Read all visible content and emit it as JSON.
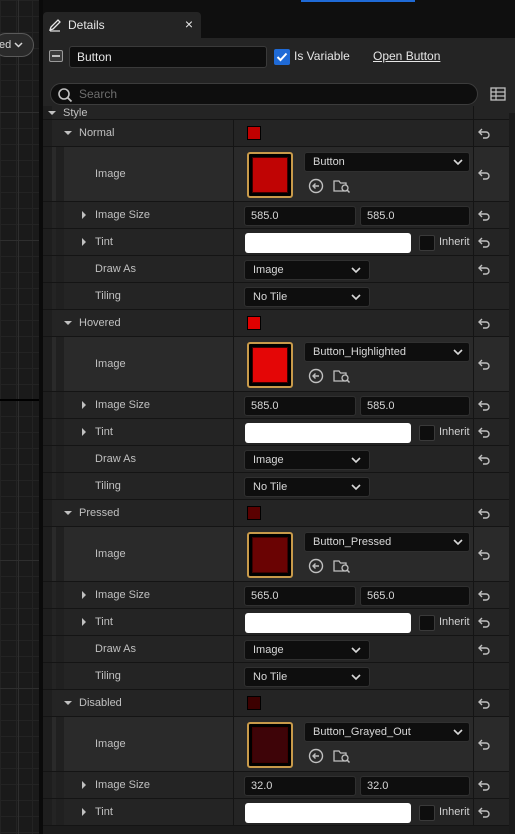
{
  "graph": {
    "dropdown_label": "ed"
  },
  "tab": {
    "title": "Details",
    "close": "×"
  },
  "header": {
    "name_value": "Button",
    "is_variable_label": "Is Variable",
    "is_variable_checked": true,
    "open_button_label": "Open Button",
    "search_placeholder": "Search"
  },
  "section": {
    "label": "Style"
  },
  "states": [
    {
      "label": "Normal",
      "swatch_color": "#c00000",
      "thumb_color": "#c00404",
      "image_name": "Button",
      "image_size": [
        "585.0",
        "585.0"
      ],
      "tint_label": "Tint",
      "inherit_label": "Inherit",
      "draw_as_label": "Draw As",
      "draw_as_value": "Image",
      "tiling_label": "Tiling",
      "tiling_value": "No Tile"
    },
    {
      "label": "Hovered",
      "swatch_color": "#e00000",
      "thumb_color": "#e40606",
      "image_name": "Button_Highlighted",
      "image_size": [
        "585.0",
        "585.0"
      ],
      "tint_label": "Tint",
      "inherit_label": "Inherit",
      "draw_as_label": "Draw As",
      "draw_as_value": "Image",
      "tiling_label": "Tiling",
      "tiling_value": "No Tile"
    },
    {
      "label": "Pressed",
      "swatch_color": "#5a0000",
      "thumb_color": "#6a0303",
      "image_name": "Button_Pressed",
      "image_size": [
        "565.0",
        "565.0"
      ],
      "tint_label": "Tint",
      "inherit_label": "Inherit",
      "draw_as_label": "Draw As",
      "draw_as_value": "Image",
      "tiling_label": "Tiling",
      "tiling_value": "No Tile"
    },
    {
      "label": "Disabled",
      "swatch_color": "#3c0000",
      "thumb_color": "#3e0408",
      "image_name": "Button_Grayed_Out",
      "image_size": [
        "32.0",
        "32.0"
      ],
      "tint_label": "Tint",
      "inherit_label": "Inherit"
    }
  ],
  "labels": {
    "image": "Image",
    "image_size": "Image Size"
  },
  "colors": {
    "accent": "#1f6ad6",
    "thumb_border": "#c89a4a",
    "panel": "#242424"
  }
}
